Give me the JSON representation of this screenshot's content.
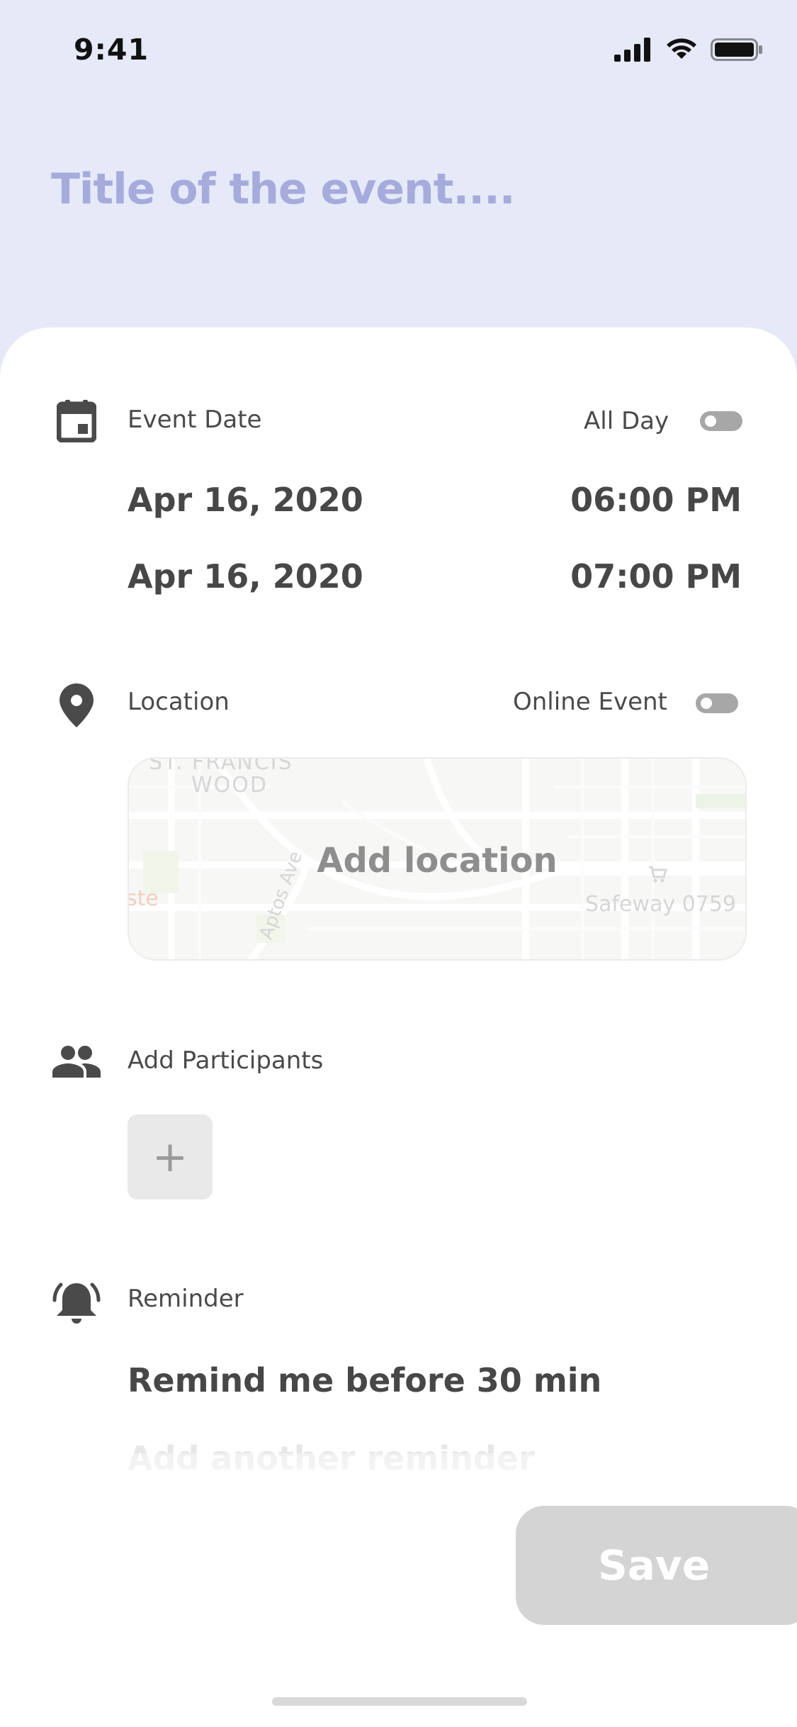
{
  "status_bar": {
    "time": "9:41"
  },
  "header": {
    "title_placeholder": "Title of the event...."
  },
  "event_date": {
    "label": "Event Date",
    "all_day_label": "All Day",
    "all_day_enabled": false,
    "start_date": "Apr 16, 2020",
    "start_time": "06:00 PM",
    "end_date": "Apr 16, 2020",
    "end_time": "07:00 PM",
    "icon": "calendar-icon"
  },
  "location": {
    "label": "Location",
    "online_label": "Online Event",
    "online_enabled": false,
    "add_label": "Add location",
    "icon": "location-pin-icon",
    "map_labels": {
      "district_top": "ST. FRANCIS",
      "district": "WOOD",
      "street": "Aptos Ave",
      "store": "Safeway 0759",
      "edge": "ste"
    }
  },
  "participants": {
    "label": "Add Participants",
    "add_symbol": "+",
    "icon": "people-icon"
  },
  "reminder": {
    "label": "Reminder",
    "value": "Remind me before 30 min",
    "add_another": "Add another reminder",
    "icon": "bell-icon"
  },
  "actions": {
    "save_label": "Save"
  },
  "colors": {
    "header_bg": "#E6E9F7",
    "title_placeholder": "#A5ACDC",
    "text_primary": "#474747",
    "save_disabled": "#D4D4D4"
  }
}
